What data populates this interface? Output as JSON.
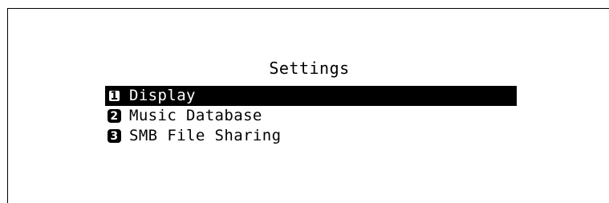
{
  "screen": {
    "title": "Settings",
    "colors": {
      "background": "#ffffff",
      "foreground": "#000000",
      "highlight": "#000000"
    }
  },
  "menu": {
    "items": [
      {
        "number": "1",
        "label": "Display",
        "selected": true,
        "icon": "number-1-icon"
      },
      {
        "number": "2",
        "label": "Music Database",
        "selected": false,
        "icon": "number-2-icon"
      },
      {
        "number": "3",
        "label": "SMB File Sharing",
        "selected": false,
        "icon": "number-3-icon"
      }
    ]
  }
}
